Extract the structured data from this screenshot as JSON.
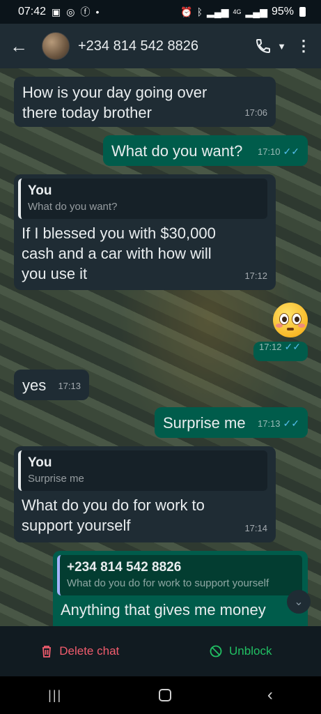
{
  "status_bar": {
    "time": "07:42",
    "battery_percent": "95%",
    "signal_label": "4G"
  },
  "header": {
    "contact": "+234 814 542 8826"
  },
  "messages": [
    {
      "dir": "in",
      "text": "How is your day going over there today brother",
      "time": "17:06"
    },
    {
      "dir": "out",
      "text": "What do you want?",
      "time": "17:10",
      "ticks": "✓✓"
    },
    {
      "dir": "in",
      "quote_author": "You",
      "quote_text": "What do you want?",
      "text": "If I blessed you with $30,000 cash and a car with how will you use it",
      "time": "17:12"
    },
    {
      "dir": "out",
      "emoji_name": "flushed-face-emoji",
      "time": "17:12",
      "ticks": "✓✓"
    },
    {
      "dir": "in",
      "text": "yes",
      "time": "17:13"
    },
    {
      "dir": "out",
      "text": "Surprise me",
      "time": "17:13",
      "ticks": "✓✓"
    },
    {
      "dir": "in",
      "quote_author": "You",
      "quote_text": "Surprise me",
      "text": "What do you do for work to support yourself",
      "time": "17:14"
    },
    {
      "dir": "out",
      "quote_author": "+234 814 542 8826",
      "quote_text": "What do you do for work to support yourself",
      "text": "Anything that gives me money"
    }
  ],
  "actions": {
    "delete_label": "Delete chat",
    "unblock_label": "Unblock"
  },
  "nav": {
    "recent": "|||",
    "back": "‹"
  },
  "colors": {
    "incoming": "#1f2c34",
    "outgoing": "#005c4b",
    "delete": "#f15c6d",
    "unblock": "#21c063",
    "read_ticks": "#53bdeb"
  }
}
